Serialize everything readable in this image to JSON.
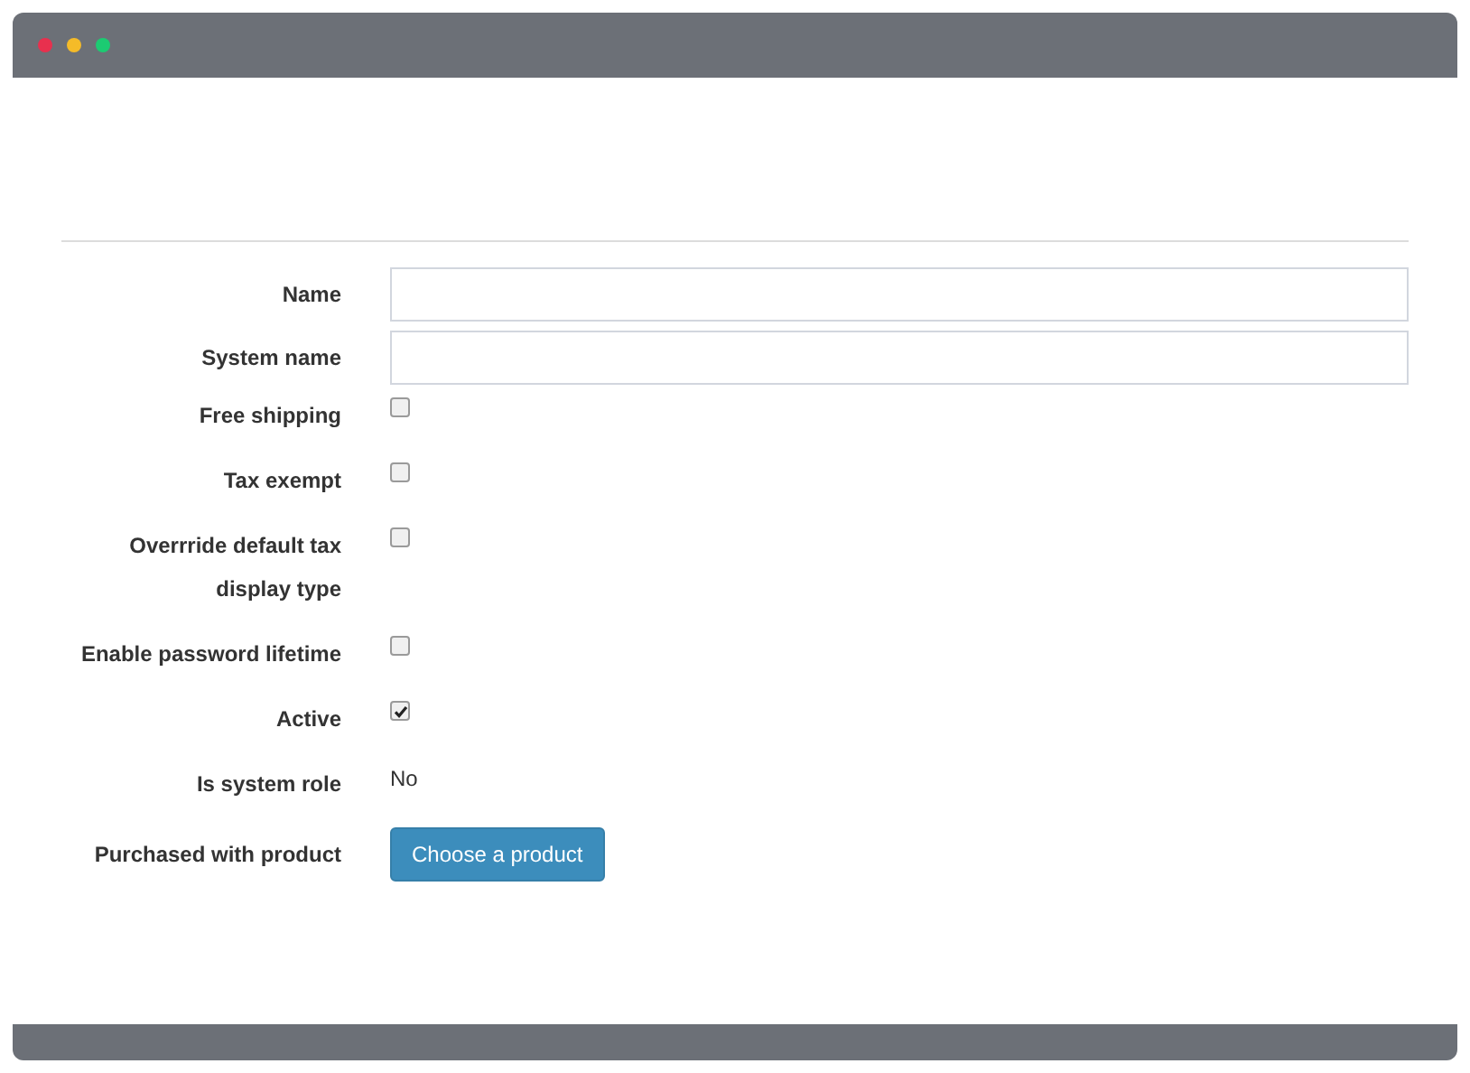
{
  "window": {
    "controls": [
      {
        "color": "#e8304e"
      },
      {
        "color": "#f5bb28"
      },
      {
        "color": "#1ccb72"
      }
    ]
  },
  "form": {
    "fields": [
      {
        "kind": "text",
        "label": "Name"
      },
      {
        "kind": "text",
        "label": "System name"
      },
      {
        "kind": "checkbox",
        "label": "Free shipping",
        "checked": false
      },
      {
        "kind": "checkbox",
        "label": "Tax exempt",
        "checked": false
      },
      {
        "kind": "checkbox",
        "label": "Overrride default tax display type",
        "checked": false
      },
      {
        "kind": "checkbox",
        "label": "Enable password lifetime",
        "checked": false
      },
      {
        "kind": "checkbox",
        "label": "Active",
        "checked": true
      },
      {
        "kind": "readonly",
        "label": "Is system role",
        "value": "No"
      },
      {
        "kind": "button",
        "label": "Purchased with product",
        "button": "Choose a product"
      }
    ]
  }
}
